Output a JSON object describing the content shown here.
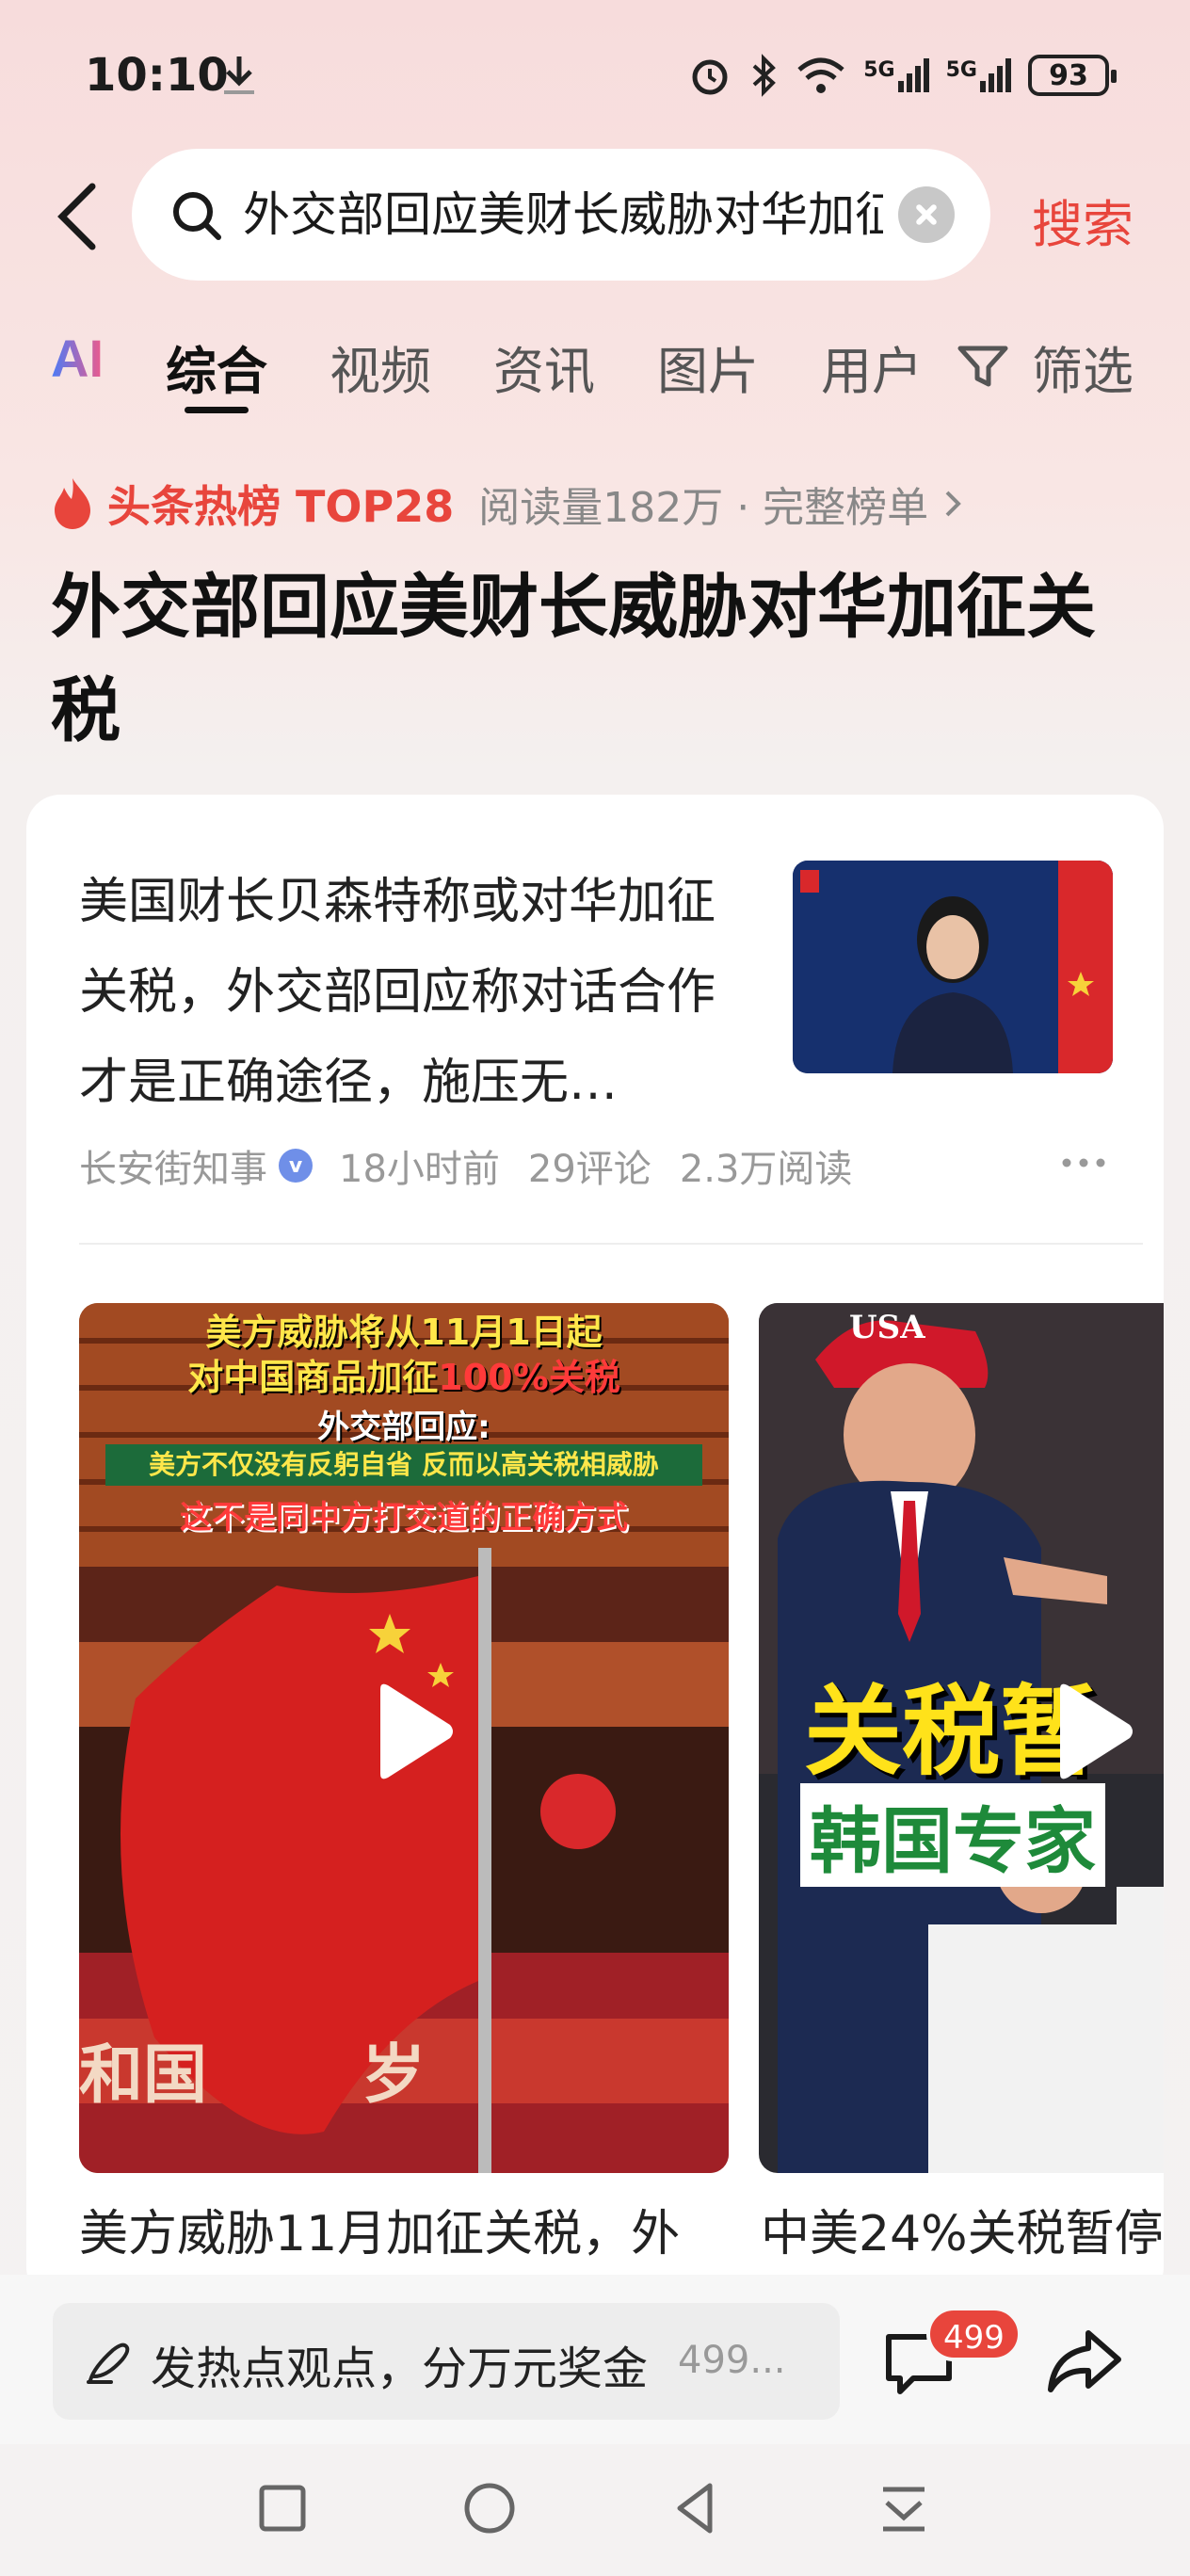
{
  "status_bar": {
    "time": "10:10",
    "signal1": "5G",
    "signal2": "5G",
    "battery": "93"
  },
  "search": {
    "query": "外交部回应美财长威胁对华加征关税",
    "button": "搜索"
  },
  "tabs": {
    "ai": "AI",
    "items": [
      "综合",
      "视频",
      "资讯",
      "图片",
      "用户"
    ],
    "filter": "筛选",
    "active_index": 0
  },
  "hot": {
    "label": "头条热榜 TOP28",
    "meta": "阅读量182万 · 完整榜单",
    "headline": "外交部回应美财长威胁对华加征关税"
  },
  "article": {
    "title": "美国财长贝森特称或对华加征关税，外交部回应称对话合作才是正确途径，施压无…",
    "source": "长安街知事",
    "time": "18小时前",
    "comments": "29评论",
    "reads": "2.3万阅读"
  },
  "videos": [
    {
      "caption": "美方威胁11月加征关税，外",
      "overlay": {
        "line1": "美方威胁将从11月1日起",
        "line2a": "对中国商品加征",
        "line2b": "100%关税",
        "line3": "外交部回应:",
        "line4": "美方不仅没有反躬自省 反而以高关税相威胁",
        "line5": "这不是同中方打交道的正确方式",
        "gate_text1": "和国",
        "gate_text2": "岁"
      }
    },
    {
      "caption": "中美24%关税暂停",
      "overlay": {
        "cap_text": "USA",
        "big_text": "关税暂",
        "sub_text": "韩国专家"
      }
    }
  ],
  "bottom": {
    "comment_placeholder": "发热点观点，分万元奖金",
    "comment_count": "499...",
    "badge": "499"
  },
  "colors": {
    "accent": "#e8453c",
    "background_top": "#f7dcdc"
  }
}
